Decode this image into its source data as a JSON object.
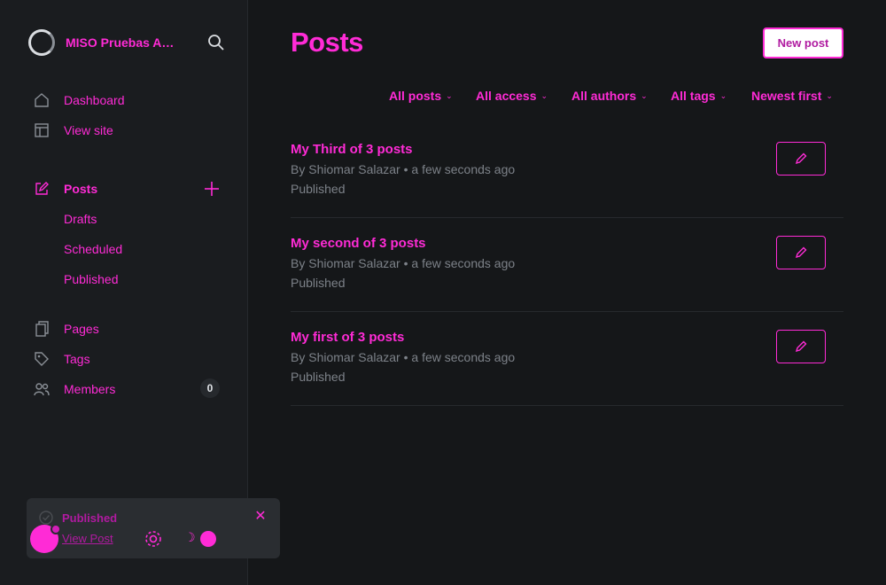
{
  "site": {
    "name": "MISO Pruebas Automatizadas"
  },
  "sidebar": {
    "items": [
      {
        "label": "Dashboard",
        "icon": "home-icon"
      },
      {
        "label": "View site",
        "icon": "layout-icon"
      },
      {
        "label": "Posts",
        "icon": "edit-icon"
      },
      {
        "label": "Drafts"
      },
      {
        "label": "Scheduled"
      },
      {
        "label": "Published"
      },
      {
        "label": "Pages",
        "icon": "pages-icon"
      },
      {
        "label": "Tags",
        "icon": "tag-icon"
      },
      {
        "label": "Members",
        "icon": "members-icon",
        "count": "0"
      }
    ]
  },
  "toast": {
    "title": "Published",
    "link": "View Post"
  },
  "main": {
    "title": "Posts",
    "new_post_label": "New post",
    "filters": [
      "All posts",
      "All access",
      "All authors",
      "All tags",
      "Newest first"
    ],
    "posts": [
      {
        "title": "My Third of 3 posts",
        "meta": "By Shiomar Salazar • a few seconds ago",
        "status": "Published"
      },
      {
        "title": "My second of 3 posts",
        "meta": "By Shiomar Salazar • a few seconds ago",
        "status": "Published"
      },
      {
        "title": "My first of 3 posts",
        "meta": "By Shiomar Salazar • a few seconds ago",
        "status": "Published"
      }
    ]
  },
  "colors": {
    "accent": "#ff2bd6",
    "background": "#151719",
    "sidebar": "#1a1c1f"
  }
}
